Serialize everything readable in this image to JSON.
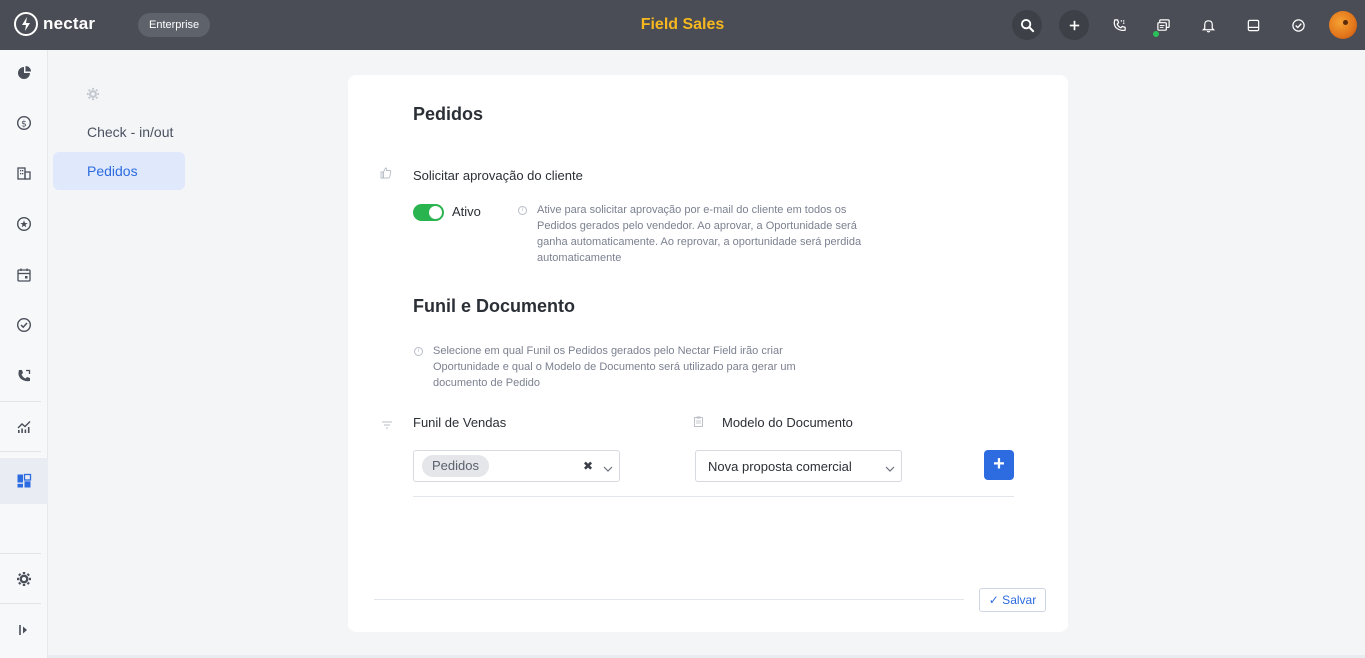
{
  "topbar": {
    "logo_text": "nectar",
    "plan_badge": "Enterprise",
    "app_title": "Field Sales",
    "icons": [
      "search-icon",
      "plus-icon",
      "phone-icon",
      "chat-icon",
      "bell-icon",
      "inbox-icon",
      "check-circle-icon",
      "avatar"
    ],
    "accent_color": "#f6b81e"
  },
  "rail": {
    "items": [
      "pie-chart-icon",
      "dollar-icon",
      "building-icon",
      "star-icon",
      "calendar-icon",
      "check-circle-icon",
      "phone-icon",
      "growth-chart-icon",
      "apps-icon"
    ],
    "active": "apps-icon",
    "bottom_items": [
      "settings-icon",
      "collapse-icon"
    ]
  },
  "submenu": {
    "items": [
      {
        "label": "Check - in/out"
      },
      {
        "label": "Pedidos"
      }
    ],
    "active": "Pedidos"
  },
  "pedidos": {
    "title": "Pedidos",
    "approval_label": "Solicitar aprovação do cliente",
    "toggle_state": "Ativo",
    "toggle_on": true,
    "approval_hint": [
      "Ative para solicitar aprovação por e-mail do cliente em todos os",
      "Pedidos gerados pelo vendedor. Ao aprovar, a Oportunidade será",
      "ganha automaticamente. Ao reprovar, a oportunidade será perdida",
      "automaticamente"
    ]
  },
  "funil": {
    "title": "Funil e Documento",
    "hint": [
      "Selecione em qual Funil os Pedidos gerados pelo Nectar Field irão criar",
      "Oportunidade e qual o Modelo de Documento será utilizado para gerar um",
      "documento de Pedido"
    ],
    "funnel_label": "Funil de Vendas",
    "funnel_selected": "Pedidos",
    "doc_label": "Modelo do Documento",
    "doc_selected": "Nova proposta comercial",
    "add_label": "+"
  },
  "save_label": "✓ Salvar",
  "colors": {
    "primary": "#2c6be0",
    "toggle_on": "#2ab44f",
    "topbar": "#4a4d55"
  }
}
